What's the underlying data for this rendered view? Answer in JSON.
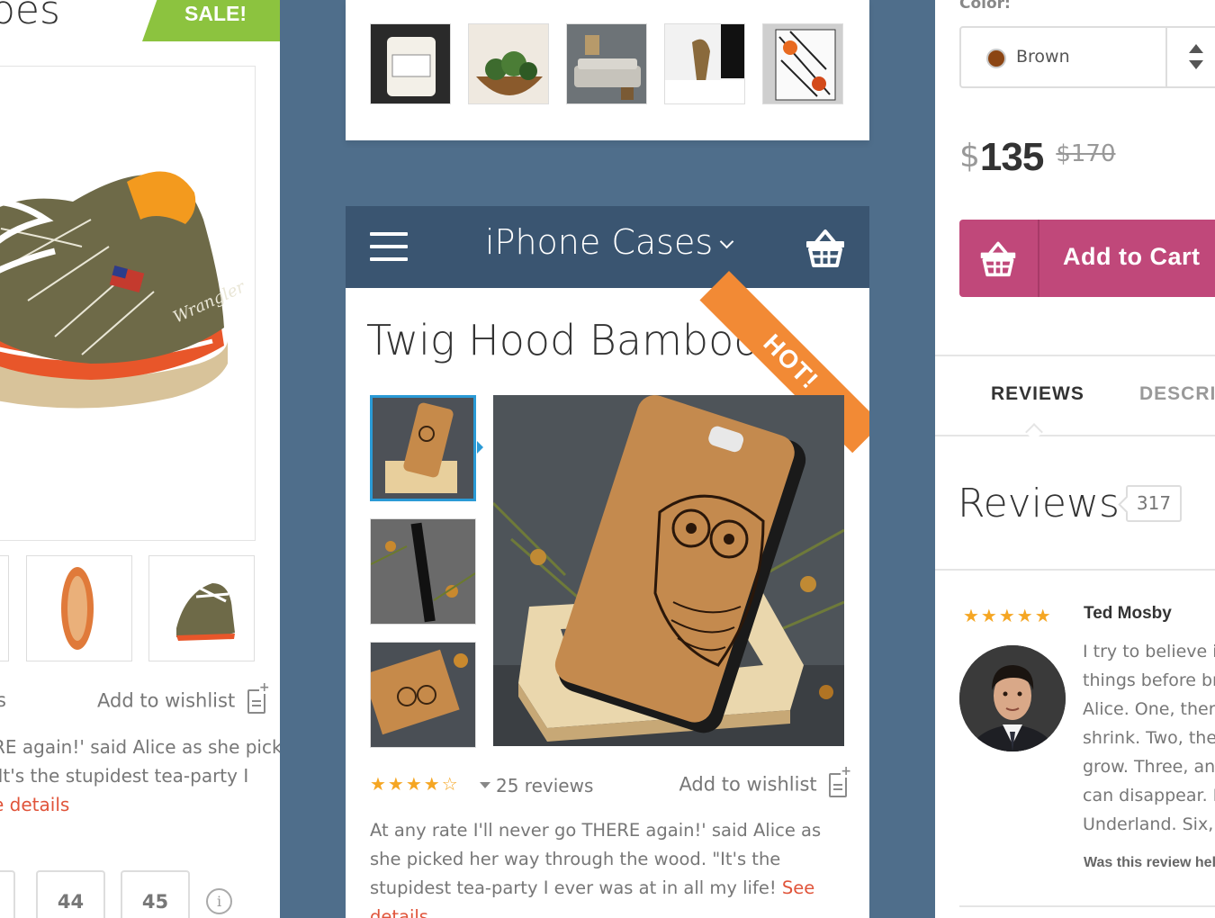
{
  "left_panel": {
    "title": "oes",
    "sale_badge": "SALE!",
    "wishlist_label": "Add to wishlist",
    "partial_left_text": "s",
    "desc_line1": "RE again!' said Alice as she picked",
    "desc_line2": "'It's the stupidest tea-party I",
    "see_details": "e details",
    "sizes": [
      "44",
      "45"
    ],
    "info_icon": "i"
  },
  "center_phone": {
    "category": "iPhone Cases",
    "product_title": "Twig Hood Bamboo",
    "hot_ribbon": "HOT!",
    "rating_stars": "★★★★☆",
    "rating_value": 4.5,
    "reviews_count": "25 reviews",
    "wishlist_label": "Add to wishlist",
    "description": "At any rate I'll never go THERE again!' said Alice as she picked her way through the wood. \"It's the stupidest tea-party I ever was at in all my life!",
    "see_details": "See details"
  },
  "right_panel": {
    "color_label": "Color:",
    "color_value": "Brown",
    "color_swatch": "#8b4513",
    "price_currency": "$",
    "price_value": "135",
    "old_price": "$170",
    "add_to_cart": "Add to Cart",
    "tabs": [
      "REVIEWS",
      "DESCRI"
    ],
    "reviews_heading": "Reviews",
    "reviews_total": "317",
    "review": {
      "stars": "★★★★★",
      "author": "Ted Mosby",
      "lines": [
        "I try to believe in",
        "things before bre",
        "Alice. One, there",
        "shrink. Two, ther",
        "grow. Three, anim",
        "can disappear. F",
        "Underland. Six, I"
      ],
      "helpful_prompt": "Was this review hel"
    }
  },
  "colors": {
    "background": "#4f6e8b",
    "header": "#3a5571",
    "sale_green": "#8cc33f",
    "hot_orange": "#f28a35",
    "cart_pink": "#c0487a",
    "star": "#f5a623",
    "link_red": "#e0543a",
    "selected_blue": "#2a9ad6"
  }
}
